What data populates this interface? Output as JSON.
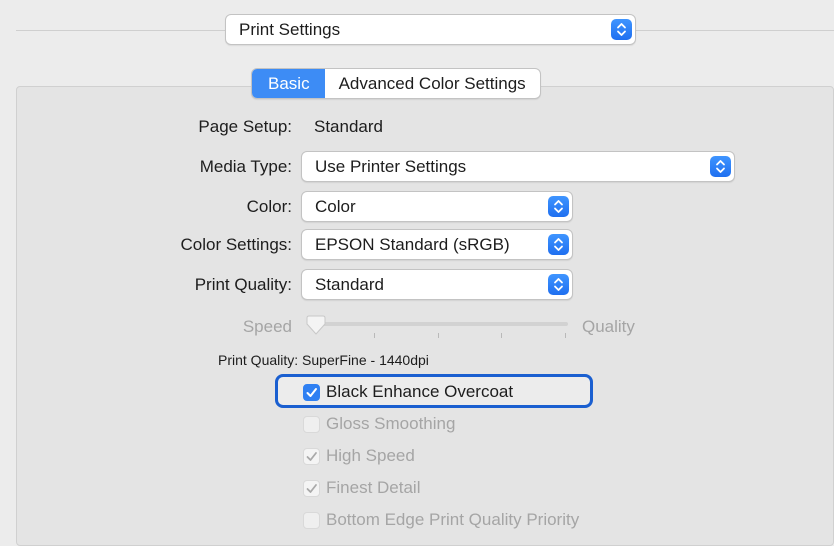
{
  "presets_popup": {
    "value": "Print Settings"
  },
  "tabs": [
    {
      "label": "Basic",
      "active": true
    },
    {
      "label": "Advanced Color Settings",
      "active": false
    }
  ],
  "page_setup": {
    "label": "Page Setup:",
    "value": "Standard"
  },
  "media_type": {
    "label": "Media Type:",
    "value": "Use Printer Settings"
  },
  "color": {
    "label": "Color:",
    "value": "Color"
  },
  "color_settings": {
    "label": "Color Settings:",
    "value": "EPSON Standard (sRGB)"
  },
  "print_quality": {
    "label": "Print Quality:",
    "value": "Standard"
  },
  "quality_slider": {
    "left_label": "Speed",
    "right_label": "Quality",
    "level": 0
  },
  "quality_readout": {
    "label": "Print Quality:",
    "value": "SuperFine - 1440dpi"
  },
  "checkboxes": [
    {
      "label": "Black Enhance Overcoat",
      "checked": true,
      "enabled": true,
      "highlighted": true
    },
    {
      "label": "Gloss Smoothing",
      "checked": false,
      "enabled": false
    },
    {
      "label": "High Speed",
      "checked": true,
      "enabled": false
    },
    {
      "label": "Finest Detail",
      "checked": true,
      "enabled": false
    },
    {
      "label": "Bottom Edge Print Quality Priority",
      "checked": false,
      "enabled": false
    }
  ],
  "colors": {
    "accent": "#3d8cf5",
    "highlight_border": "#1a5fd0",
    "disabled_text": "#a5a5a5"
  }
}
